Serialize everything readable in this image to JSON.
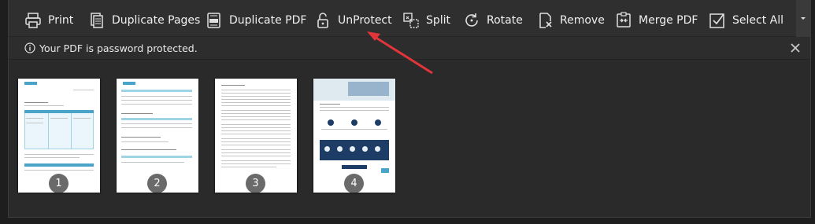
{
  "toolbar": {
    "print": "Print",
    "duplicate_pages": "Duplicate Pages",
    "duplicate_pdf": "Duplicate PDF",
    "unprotect": "UnProtect",
    "split": "Split",
    "rotate": "Rotate",
    "remove": "Remove",
    "merge_pdf": "Merge PDF",
    "select_all": "Select All"
  },
  "infobar": {
    "message": "Your PDF is password protected."
  },
  "pages": [
    {
      "number": "1"
    },
    {
      "number": "2"
    },
    {
      "number": "3"
    },
    {
      "number": "4"
    }
  ],
  "colors": {
    "accent_blue": "#4aa3c8",
    "annotation_arrow": "#e0353a"
  }
}
